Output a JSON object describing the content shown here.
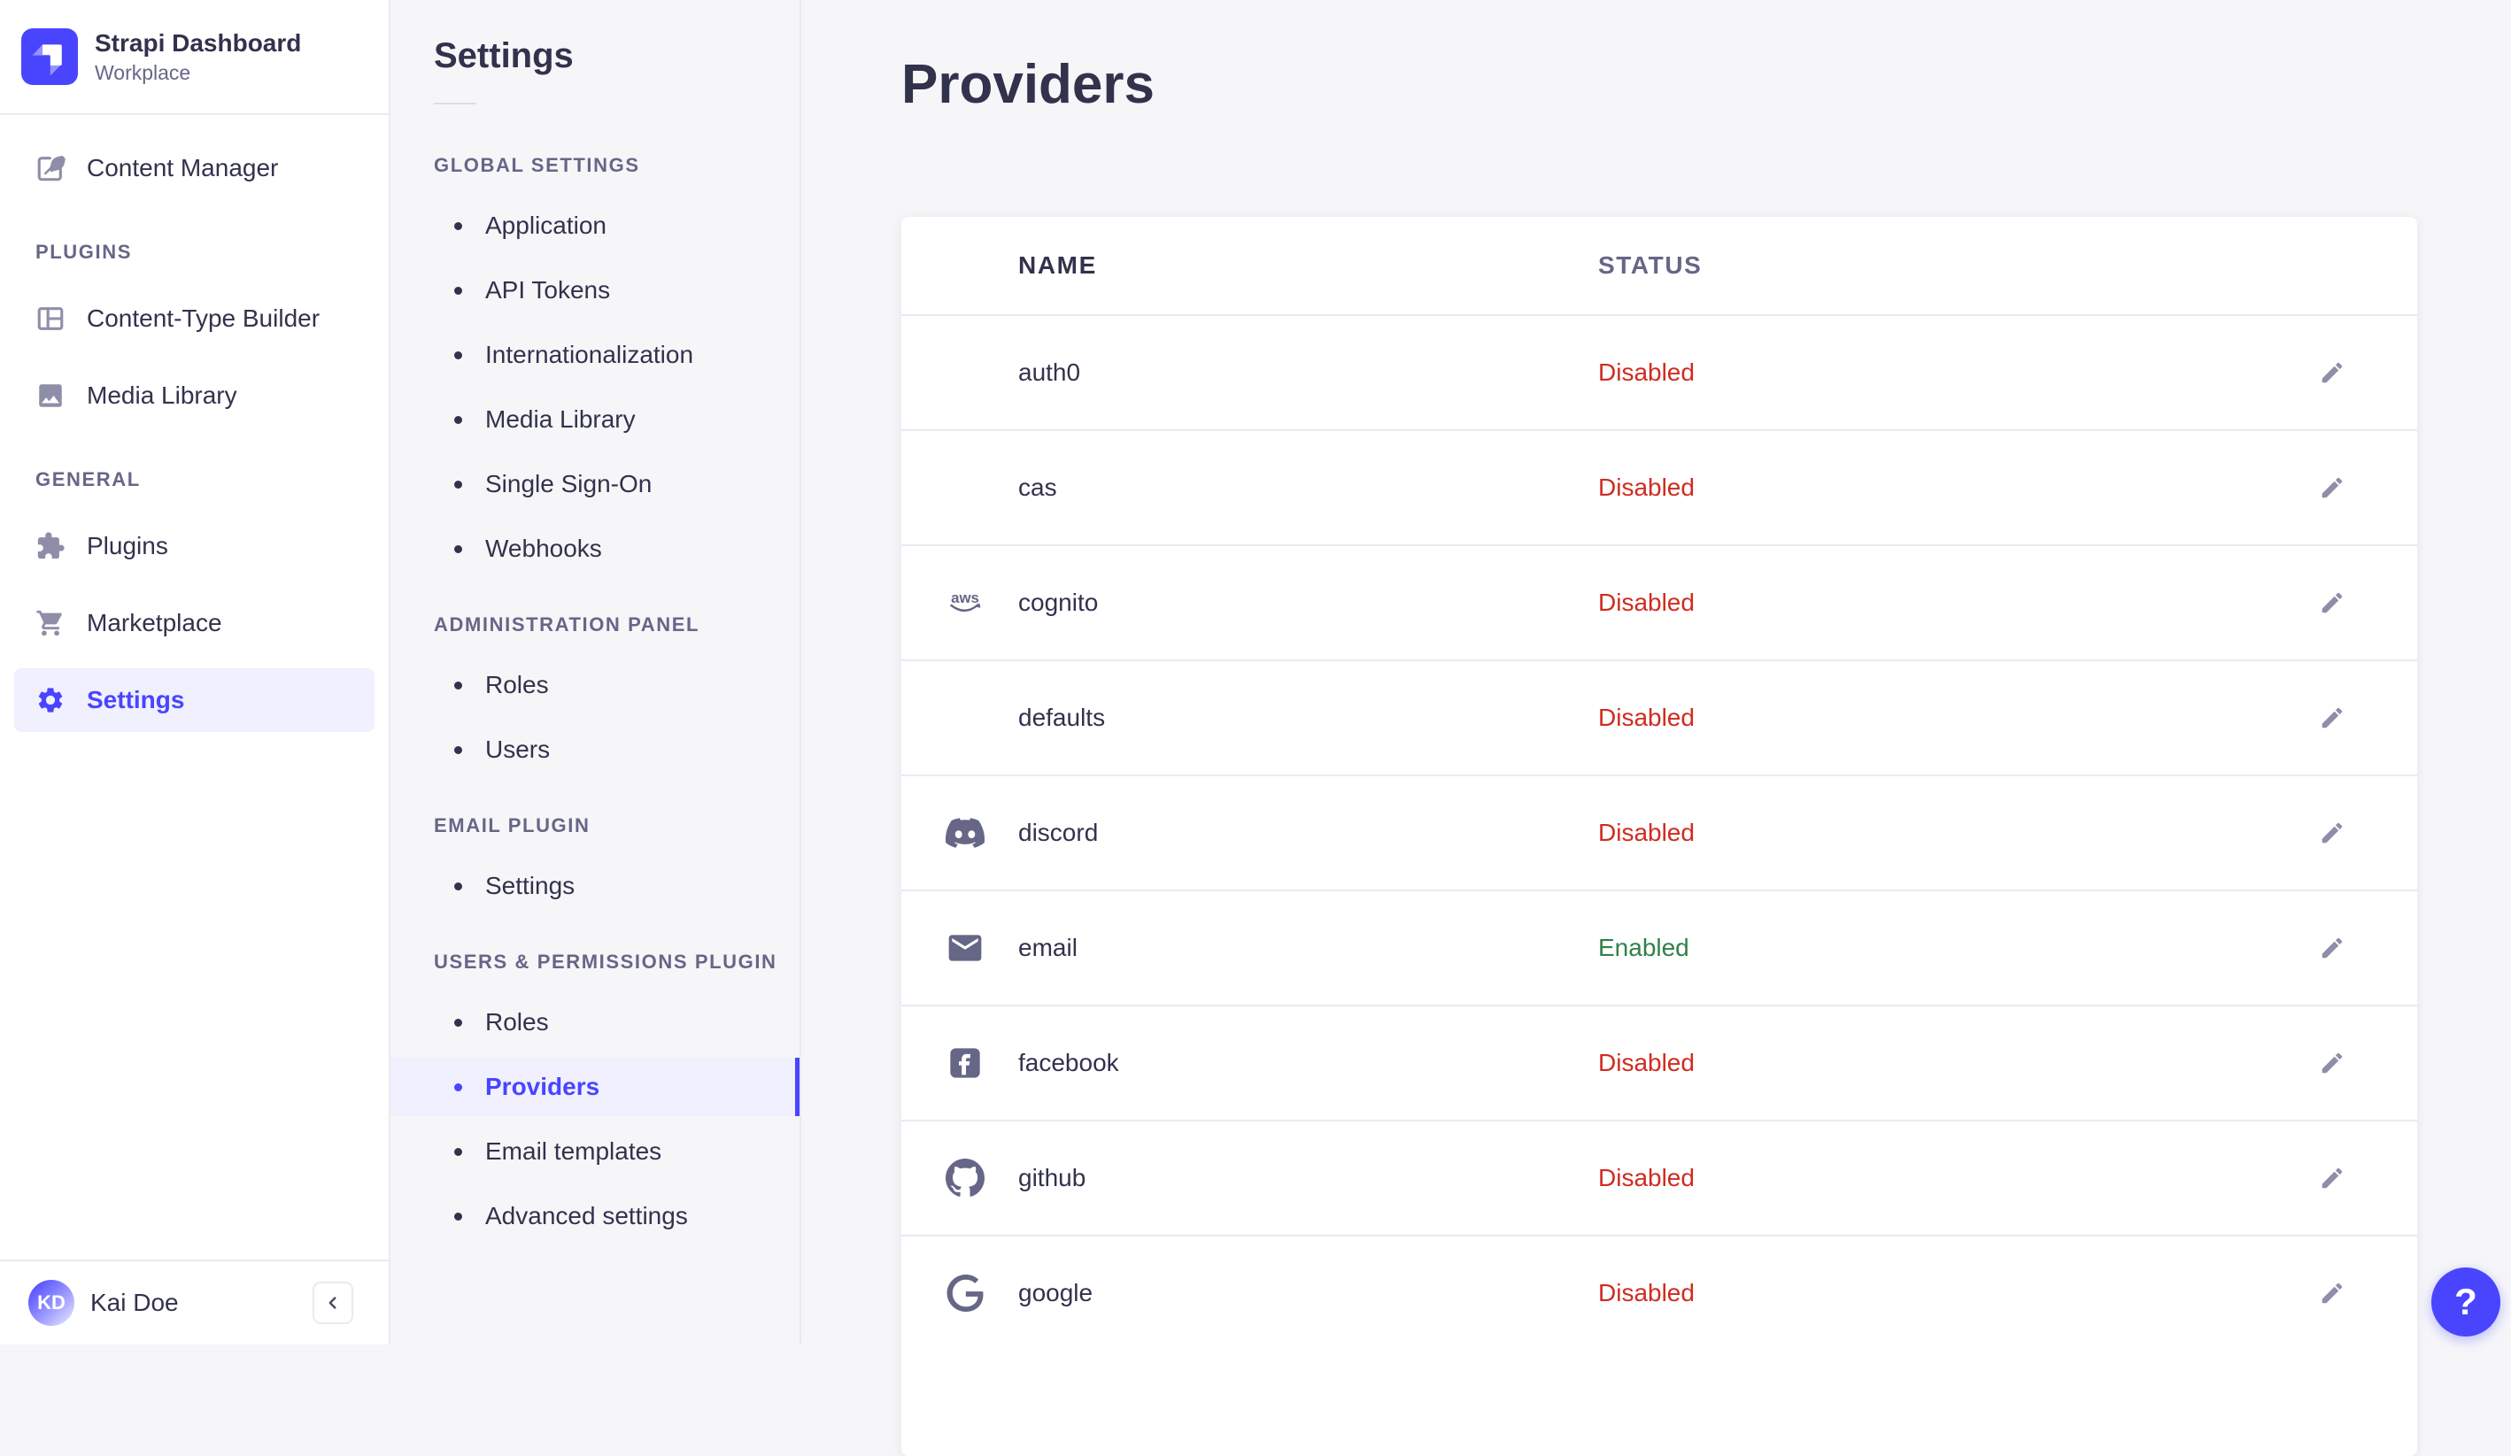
{
  "colors": {
    "accent": "#4945ff",
    "accent_light_bg": "#f0f0ff",
    "danger": "#d02b20",
    "success": "#328048",
    "text": "#32324d",
    "muted_text": "#666687",
    "muted_icon": "#8e8ea9",
    "border": "#eaeaef",
    "page_bg": "#f6f6f9",
    "card_bg": "#ffffff"
  },
  "sidebar": {
    "brand": {
      "title": "Strapi Dashboard",
      "subtitle": "Workplace",
      "logo_icon": "strapi-logo"
    },
    "nav": [
      {
        "type": "item",
        "icon": "content-manager",
        "label": "Content Manager",
        "active": false
      },
      {
        "type": "section",
        "label": "PLUGINS"
      },
      {
        "type": "item",
        "icon": "content-type-builder",
        "label": "Content-Type Builder",
        "active": false
      },
      {
        "type": "item",
        "icon": "media-library",
        "label": "Media Library",
        "active": false
      },
      {
        "type": "section",
        "label": "GENERAL"
      },
      {
        "type": "item",
        "icon": "plugins",
        "label": "Plugins",
        "active": false
      },
      {
        "type": "item",
        "icon": "marketplace",
        "label": "Marketplace",
        "active": false
      },
      {
        "type": "item",
        "icon": "settings",
        "label": "Settings",
        "active": true
      }
    ],
    "user": {
      "initials": "KD",
      "name": "Kai Doe"
    },
    "collapse_icon": "chevron-left"
  },
  "subnav": {
    "title": "Settings",
    "sections": [
      {
        "label": "GLOBAL SETTINGS",
        "items": [
          {
            "label": "Application",
            "active": false
          },
          {
            "label": "API Tokens",
            "active": false
          },
          {
            "label": "Internationalization",
            "active": false
          },
          {
            "label": "Media Library",
            "active": false
          },
          {
            "label": "Single Sign-On",
            "active": false
          },
          {
            "label": "Webhooks",
            "active": false
          }
        ]
      },
      {
        "label": "ADMINISTRATION PANEL",
        "items": [
          {
            "label": "Roles",
            "active": false
          },
          {
            "label": "Users",
            "active": false
          }
        ]
      },
      {
        "label": "EMAIL PLUGIN",
        "items": [
          {
            "label": "Settings",
            "active": false
          }
        ]
      },
      {
        "label": "USERS & PERMISSIONS PLUGIN",
        "items": [
          {
            "label": "Roles",
            "active": false
          },
          {
            "label": "Providers",
            "active": true
          },
          {
            "label": "Email templates",
            "active": false
          },
          {
            "label": "Advanced settings",
            "active": false
          }
        ]
      }
    ]
  },
  "main": {
    "title": "Providers",
    "table": {
      "columns": [
        "NAME",
        "STATUS"
      ],
      "rows": [
        {
          "name": "auth0",
          "icon": null,
          "status": "Disabled"
        },
        {
          "name": "cas",
          "icon": null,
          "status": "Disabled"
        },
        {
          "name": "cognito",
          "icon": "aws",
          "status": "Disabled"
        },
        {
          "name": "defaults",
          "icon": null,
          "status": "Disabled"
        },
        {
          "name": "discord",
          "icon": "discord",
          "status": "Disabled"
        },
        {
          "name": "email",
          "icon": "email",
          "status": "Enabled"
        },
        {
          "name": "facebook",
          "icon": "facebook",
          "status": "Disabled"
        },
        {
          "name": "github",
          "icon": "github",
          "status": "Disabled"
        },
        {
          "name": "google",
          "icon": "google",
          "status": "Disabled"
        }
      ],
      "edit_action_icon": "edit"
    }
  },
  "help": {
    "label": "?"
  }
}
